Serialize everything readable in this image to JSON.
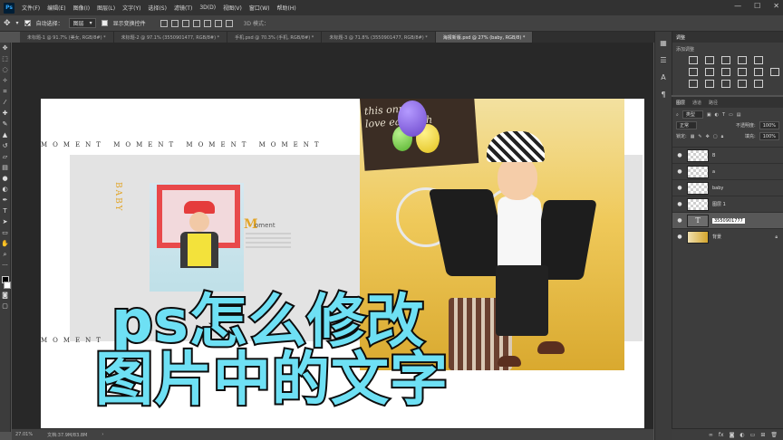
{
  "app": {
    "logo": "Ps"
  },
  "menu": [
    "文件(F)",
    "编辑(E)",
    "图像(I)",
    "图层(L)",
    "文字(Y)",
    "选择(S)",
    "滤镜(T)",
    "3D(D)",
    "视图(V)",
    "窗口(W)",
    "帮助(H)"
  ],
  "window_controls": {
    "minimize": "—",
    "maximize": "☐",
    "close": "✕"
  },
  "options": {
    "auto_select_label": "自动选择：",
    "auto_select_value": "图层",
    "show_transform_label": "显示变换控件",
    "mode3d_label": "3D 模式："
  },
  "tabs": [
    {
      "label": "未标题-1 @ 91.7% (美女, RGB/8#) *"
    },
    {
      "label": "未标题-2 @ 97.1% (3550901477, RGB/8#) *"
    },
    {
      "label": "手机.psd @ 70.3% (手机, RGB/8#) *"
    },
    {
      "label": "未标题-3 @ 71.8% (3550901477, RGB/8#) *"
    },
    {
      "label": "海报新版.psd @ 27% (baby, RGB/8) *"
    }
  ],
  "canvas": {
    "moment_top": "MOMENT  MOMENT  MOMENT  MOMENT",
    "moment_bottom": "MOMENT",
    "baby": "BABY",
    "m_letter": "M",
    "m_rest": "oment",
    "sign_text_1": "this  onnel",
    "sign_text_2": "love each oth"
  },
  "overlay": {
    "line1": "ps怎么修改",
    "line2": "图片中的文字"
  },
  "status": {
    "zoom": "27.01%",
    "doc": "文档:37.9M/83.8M"
  },
  "adjust_panel": {
    "tab": "调整",
    "subtitle": "添加调整"
  },
  "layers_panel": {
    "tabs": [
      "图层",
      "通道",
      "路径"
    ],
    "kind_label": "类型",
    "blend_mode": "正常",
    "opacity_label": "不透明度:",
    "opacity_value": "100%",
    "lock_label": "锁定:",
    "fill_label": "填充:",
    "fill_value": "100%",
    "layers": [
      {
        "name": "B",
        "type": "raster"
      },
      {
        "name": "a",
        "type": "raster"
      },
      {
        "name": "baby",
        "type": "raster"
      },
      {
        "name": "图层 1",
        "type": "raster"
      },
      {
        "name": "3550901777",
        "type": "text",
        "editing": true
      },
      {
        "name": "背景",
        "type": "photo",
        "locked": true
      }
    ]
  },
  "colors": {
    "accent_overlay": "#6ee0f4",
    "ps_blue": "#31a8ff"
  }
}
